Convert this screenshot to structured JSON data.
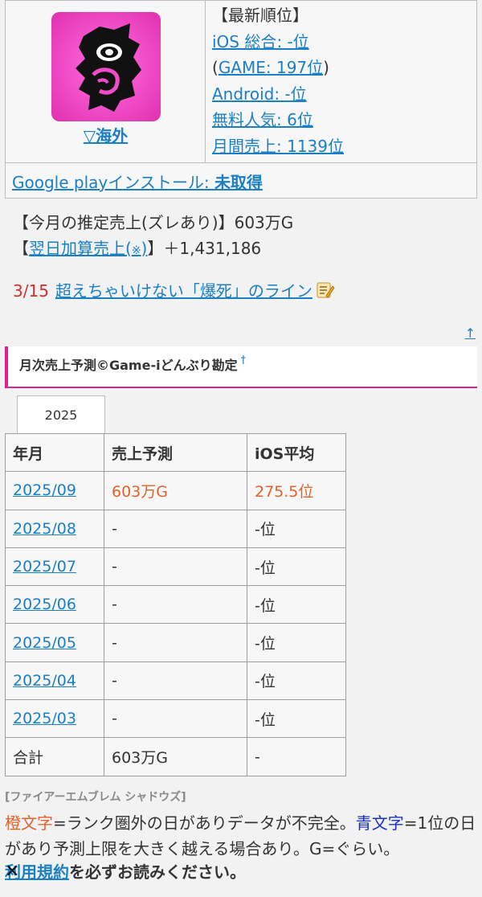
{
  "header": {
    "overseas_label": "▽海外",
    "rank_title": "【最新順位】",
    "ios_total": "iOS 総合: -位",
    "game_paren_open": "(",
    "game_rank": "GAME: 197位",
    "game_paren_close": ")",
    "android": "Android: -位",
    "free_popular": "無料人気: 6位",
    "monthly_sales": "月間売上: 1139位",
    "gp_install_prefix": "Google playインストール: ",
    "gp_install_value": "未取得"
  },
  "estimate": {
    "label": "【今月の推定売上(ズレあり)】603万G",
    "nextday_open": "【",
    "nextday_link": "翌日加算売上(",
    "nextday_mark": "※",
    "nextday_link_close": ")",
    "nextday_close": "】＋1,431,186"
  },
  "event": {
    "date": "3/15",
    "text": "超えちゃいけない「爆死」のライン"
  },
  "up_arrow": "↑",
  "section": {
    "title": "月次売上予測©Game-iどんぶり勘定",
    "dagger": "†"
  },
  "year_tab": "2025",
  "table": {
    "headers": [
      "年月",
      "売上予測",
      "iOS平均"
    ],
    "rows": [
      {
        "month": "2025/09",
        "sales": "603万G",
        "ios": "275.5位",
        "highlight": true
      },
      {
        "month": "2025/08",
        "sales": "-",
        "ios": "-位",
        "highlight": false
      },
      {
        "month": "2025/07",
        "sales": "-",
        "ios": "-位",
        "highlight": false
      },
      {
        "month": "2025/06",
        "sales": "-",
        "ios": "-位",
        "highlight": false
      },
      {
        "month": "2025/05",
        "sales": "-",
        "ios": "-位",
        "highlight": false
      },
      {
        "month": "2025/04",
        "sales": "-",
        "ios": "-位",
        "highlight": false
      },
      {
        "month": "2025/03",
        "sales": "-",
        "ios": "-位",
        "highlight": false
      }
    ],
    "total": {
      "label": "合計",
      "sales": "603万G",
      "ios": "-"
    }
  },
  "footer": {
    "game_title": "[ファイアーエムブレム シャドウズ]",
    "orange_word": "橙文字",
    "orange_desc": "=ランク圏外の日がありデータが不完全。",
    "blue_word": "青文字",
    "blue_desc": "=1位の日があり予測上限を大きく越える場合あり。G=ぐらい。",
    "terms_link": "利用規約",
    "terms_rest": "を必ずお読みください。",
    "close": "✕"
  },
  "colors": {
    "link": "#1a7fc4",
    "accent_pink": "#e0208e",
    "orange": "#e2622b",
    "blue_note": "#1a2fc4",
    "event_date_red": "#d32f2f"
  }
}
